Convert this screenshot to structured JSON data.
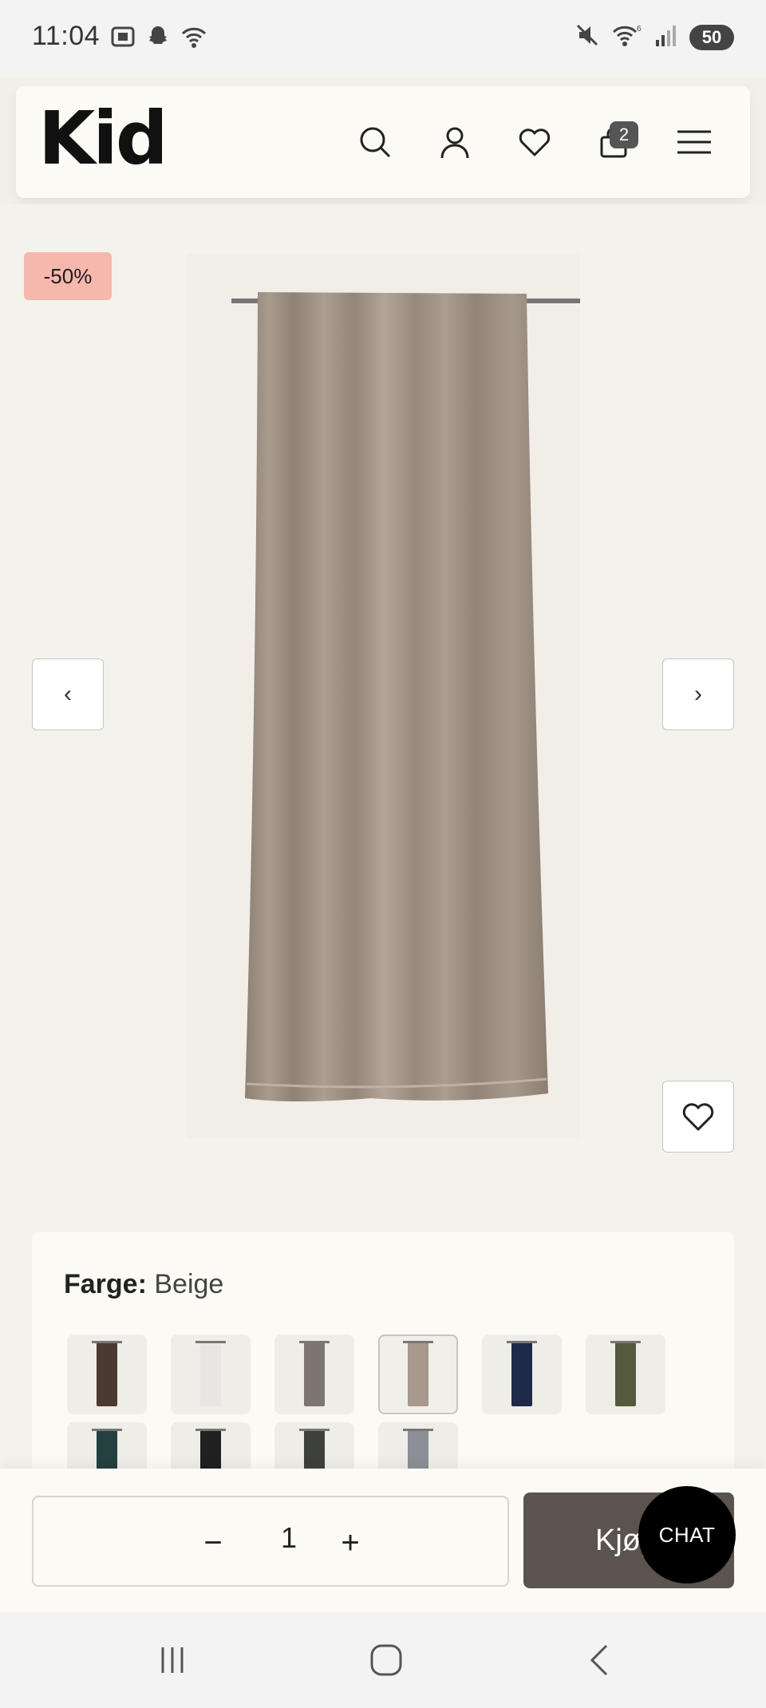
{
  "status_bar": {
    "time": "11:04",
    "battery": "50",
    "left_icons": [
      "screenshot-icon",
      "snapchat-icon",
      "wifi-icon"
    ],
    "right_icons": [
      "mute-icon",
      "wifi-6-icon",
      "signal-icon",
      "battery-icon"
    ]
  },
  "header": {
    "logo": "Kid",
    "cart_count": "2",
    "icons": [
      "search-icon",
      "account-icon",
      "heart-icon",
      "bag-icon",
      "menu-icon"
    ]
  },
  "product": {
    "discount_badge": "-50%",
    "prev_label": "‹",
    "next_label": "›"
  },
  "color_selector": {
    "label": "Farge:",
    "selected_value": "Beige",
    "swatches": [
      {
        "color": "#4a3a31",
        "selected": false
      },
      {
        "color": "#e8e6e2",
        "selected": false
      },
      {
        "color": "#7c7570",
        "selected": false
      },
      {
        "color": "#a6988a",
        "selected": true
      },
      {
        "color": "#1f2a4a",
        "selected": false
      },
      {
        "color": "#555a3e",
        "selected": false
      },
      {
        "color": "#24403f",
        "selected": false
      },
      {
        "color": "#202020",
        "selected": false
      },
      {
        "color": "#3e403c",
        "selected": false
      },
      {
        "color": "#8d8f96",
        "selected": false
      }
    ]
  },
  "purchase": {
    "qty_minus": "−",
    "quantity": "1",
    "qty_plus": "+",
    "buy_label": "Kjøp",
    "chat_label": "CHAT"
  },
  "colors": {
    "background": "#f4f2ec",
    "discount": "#f6b8ad",
    "buy_button": "#5a534e",
    "curtain": "#9c8e80"
  }
}
